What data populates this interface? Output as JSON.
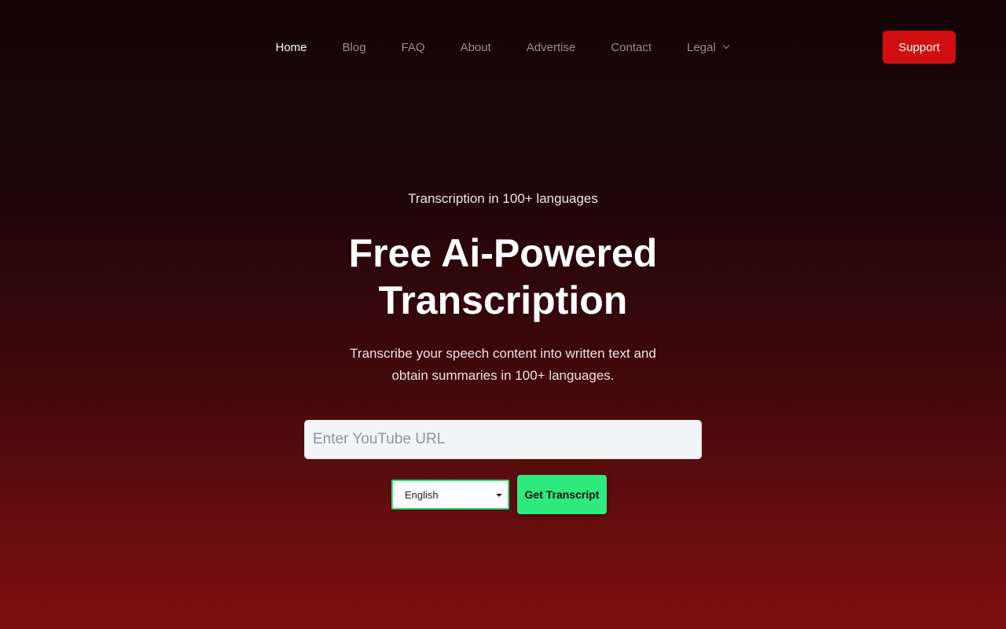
{
  "nav": {
    "items": [
      {
        "label": "Home"
      },
      {
        "label": "Blog"
      },
      {
        "label": "FAQ"
      },
      {
        "label": "About"
      },
      {
        "label": "Advertise"
      },
      {
        "label": "Contact"
      },
      {
        "label": "Legal"
      }
    ],
    "support_label": "Support"
  },
  "hero": {
    "eyebrow": "Transcription in 100+ languages",
    "headline_line1": "Free Ai-Powered",
    "headline_line2": "Transcription",
    "sub_line1": "Transcribe your speech content into written text and",
    "sub_line2": "obtain summaries in 100+ languages."
  },
  "form": {
    "url_placeholder": "Enter YouTube URL",
    "url_value": "",
    "language_selected": "English",
    "submit_label": "Get Transcript"
  },
  "colors": {
    "accent_red": "#d10f10",
    "accent_green": "#2ee97b"
  },
  "icons": {
    "legal_dropdown": "chevron-down-icon",
    "language_dropdown": "caret-down-icon"
  }
}
